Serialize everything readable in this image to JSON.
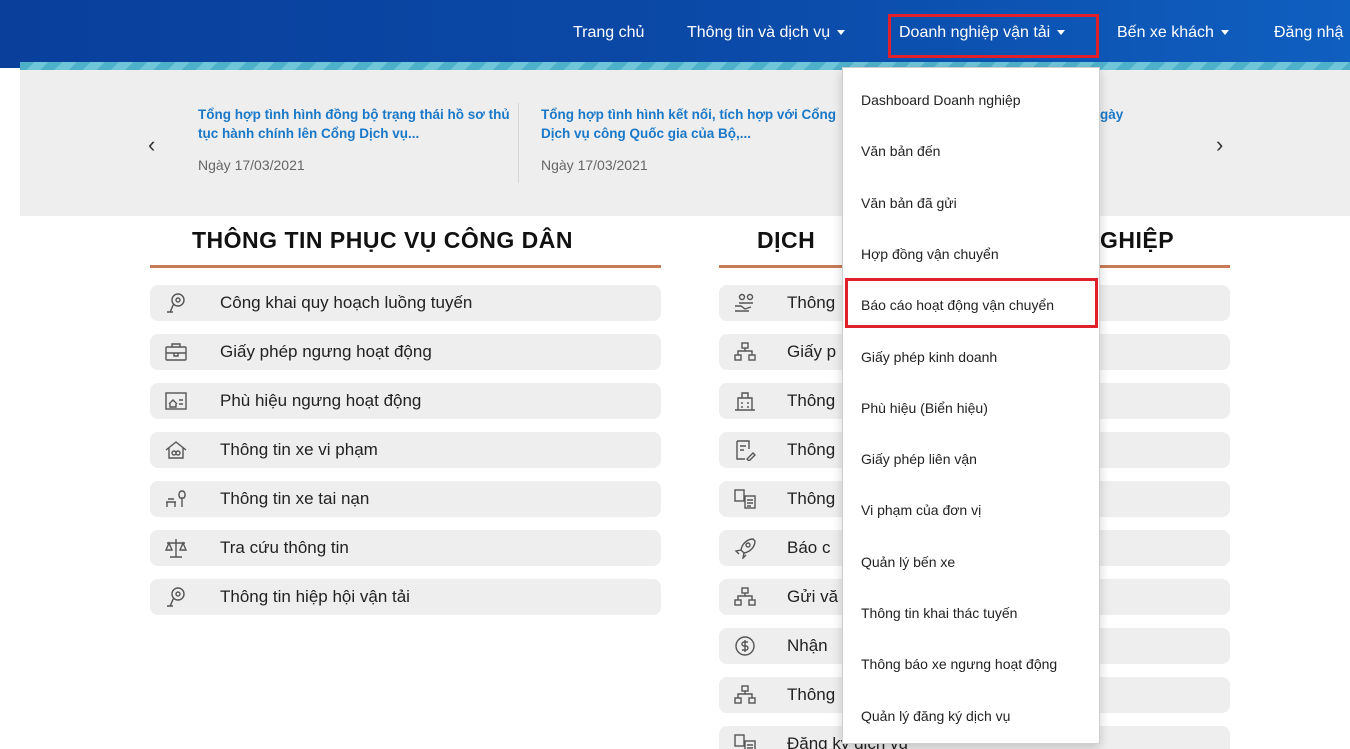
{
  "nav": {
    "items": [
      {
        "label": "Trang chủ",
        "caret": false
      },
      {
        "label": "Thông tin và dịch vụ",
        "caret": true
      },
      {
        "label": "Doanh nghiệp vận tải",
        "caret": true
      },
      {
        "label": "Bến xe khách",
        "caret": true
      },
      {
        "label": "Đăng nhậ",
        "caret": false
      }
    ],
    "active": "Doanh nghiệp vận tải",
    "colors": {
      "bar": "#0b4aa8",
      "highlight": "#e0202a"
    }
  },
  "news": {
    "prev_icon": "chevron-left-icon",
    "next_icon": "chevron-right-icon",
    "items": [
      {
        "title": "Tổng hợp tình hình đồng bộ trạng thái hồ sơ thủ tục hành chính lên Cổng Dịch vụ...",
        "date": "Ngày 17/03/2021"
      },
      {
        "title": "Tổng hợp tình hình kết nối, tích hợp với Cổng Dịch vụ công Quốc gia của Bộ,...",
        "date": "Ngày 17/03/2021"
      },
      {
        "title": "gày",
        "date": ""
      }
    ],
    "colors": {
      "title": "#1a78c8"
    }
  },
  "left_section": {
    "title": "THÔNG TIN PHỤC VỤ CÔNG DÂN",
    "items": [
      {
        "label": "Công khai quy hoạch luồng tuyến",
        "icon": "network-icon"
      },
      {
        "label": "Giấy phép ngưng hoạt động",
        "icon": "briefcase-icon"
      },
      {
        "label": "Phù hiệu ngưng hoạt động",
        "icon": "id-card-icon"
      },
      {
        "label": "Thông tin xe vi phạm",
        "icon": "house-icon"
      },
      {
        "label": "Thông tin xe tai nạn",
        "icon": "bench-tree-icon"
      },
      {
        "label": "Tra cứu thông tin",
        "icon": "scales-icon"
      },
      {
        "label": "Thông tin hiệp hội vận tải",
        "icon": "network-icon"
      }
    ]
  },
  "right_section": {
    "title_left": "DỊCH",
    "title_right": "GHIỆP",
    "items": [
      {
        "label": "Thông",
        "icon": "hand-people-icon"
      },
      {
        "label": "Giấy p",
        "icon": "sitemap-icon"
      },
      {
        "label": "Thông",
        "icon": "building-icon"
      },
      {
        "label": "Thông",
        "icon": "document-edit-icon"
      },
      {
        "label": "Thông",
        "icon": "documents-icon"
      },
      {
        "label": "Báo c",
        "icon": "rocket-icon"
      },
      {
        "label": "Gửi vă",
        "icon": "sitemap-icon"
      },
      {
        "label": "Nhận",
        "icon": "dollar-icon"
      },
      {
        "label": "Thông",
        "icon": "sitemap-icon"
      },
      {
        "label": "Đăng ký dịch vụ",
        "icon": "documents-icon"
      }
    ]
  },
  "dropdown": {
    "items": [
      "Dashboard Doanh nghiệp",
      "Văn bản đến",
      "Văn bản đã gửi",
      "Hợp đồng vận chuyển",
      "Báo cáo hoạt động vận chuyển",
      "Giấy phép kinh doanh",
      "Phù hiệu (Biển hiệu)",
      "Giấy phép liên vận",
      "Vi phạm của đơn vị",
      "Quản lý bến xe",
      "Thông tin khai thác tuyến",
      "Thông báo xe ngưng hoạt động",
      "Quản lý đăng ký dịch vụ"
    ],
    "highlighted": "Báo cáo hoạt động vận chuyển"
  }
}
